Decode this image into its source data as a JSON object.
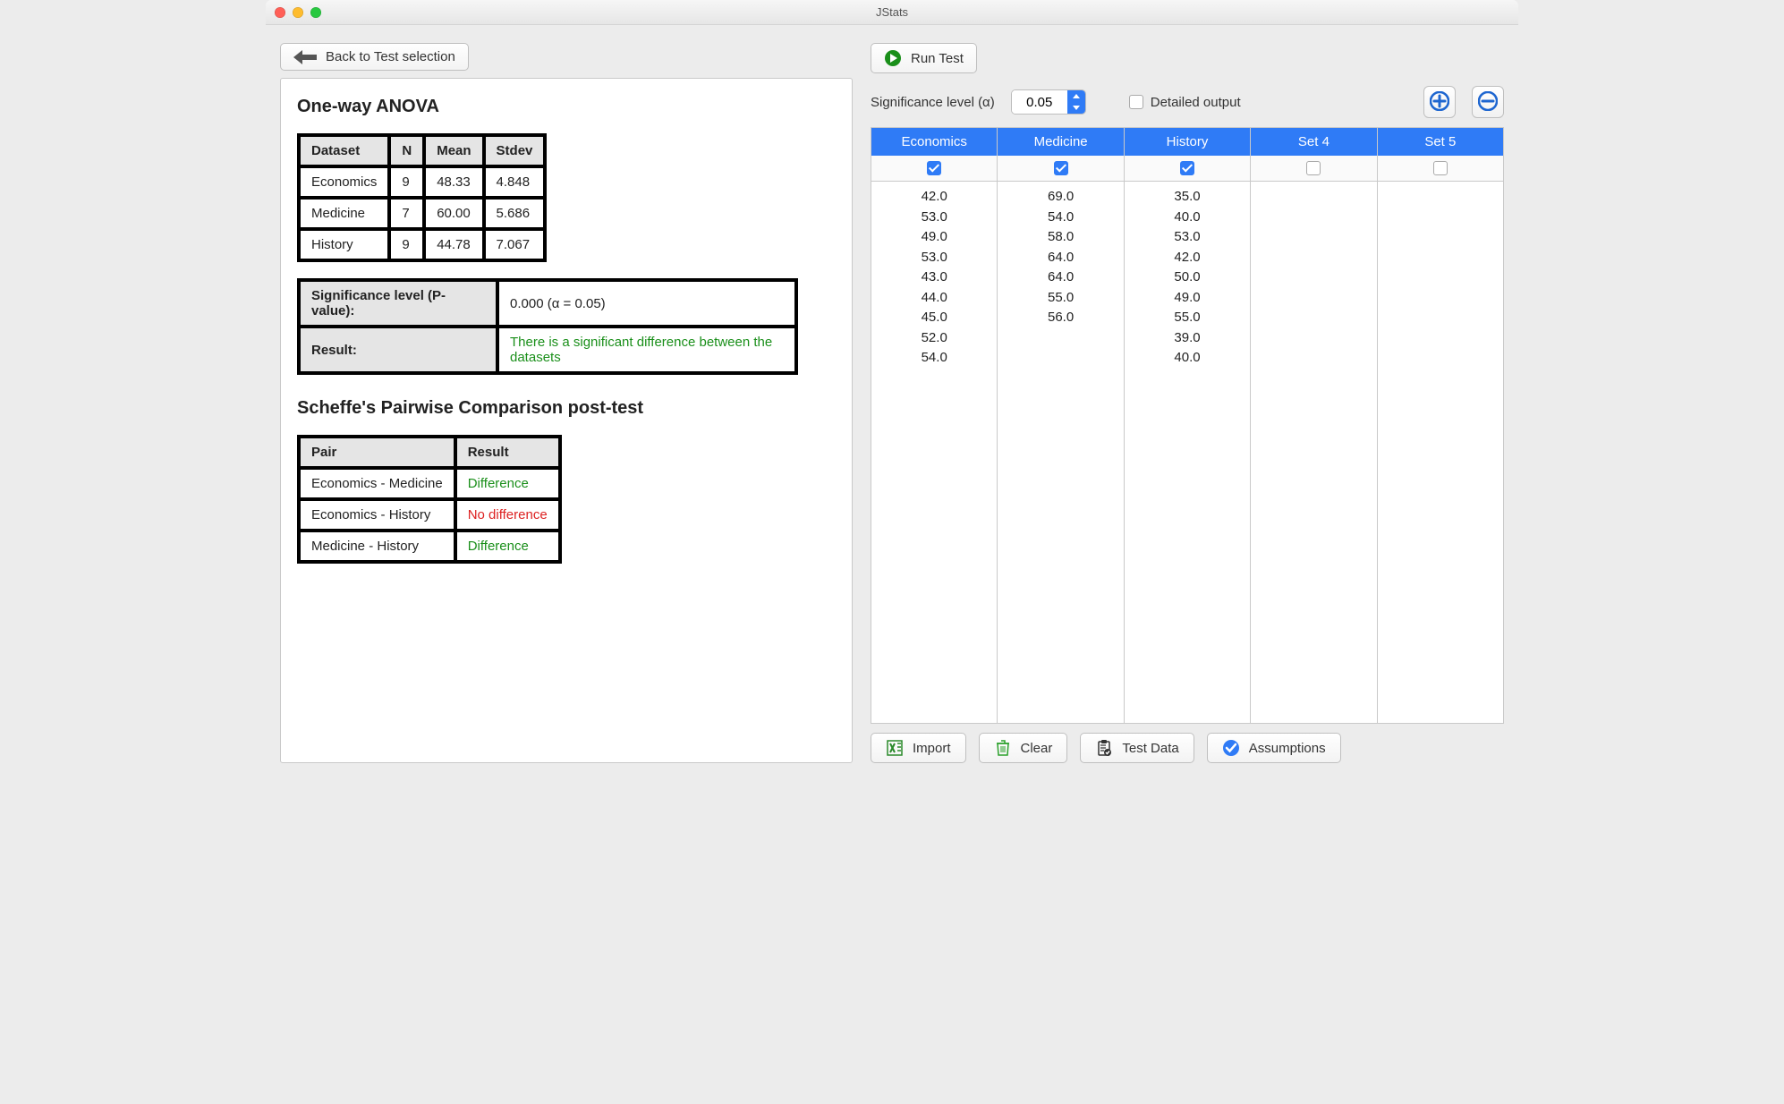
{
  "window": {
    "title": "JStats"
  },
  "buttons": {
    "back": "Back to Test selection",
    "run": "Run Test",
    "import": "Import",
    "clear": "Clear",
    "testdata": "Test Data",
    "assumptions": "Assumptions"
  },
  "options": {
    "sig_label": "Significance level (α)",
    "sig_value": "0.05",
    "detailed_label": "Detailed output"
  },
  "output": {
    "heading1": "One-way ANOVA",
    "stats_headers": {
      "dataset": "Dataset",
      "n": "N",
      "mean": "Mean",
      "stdev": "Stdev"
    },
    "stats": [
      {
        "name": "Economics",
        "n": "9",
        "mean": "48.33",
        "stdev": "4.848"
      },
      {
        "name": "Medicine",
        "n": "7",
        "mean": "60.00",
        "stdev": "5.686"
      },
      {
        "name": "History",
        "n": "9",
        "mean": "44.78",
        "stdev": "7.067"
      }
    ],
    "sig_row_label": "Significance level (P-value):",
    "sig_row_value": "0.000  (α = 0.05)",
    "result_label": "Result:",
    "result_value": "There is a significant difference between the datasets",
    "heading2": "Scheffe's Pairwise Comparison post-test",
    "pair_headers": {
      "pair": "Pair",
      "result": "Result"
    },
    "pairs": [
      {
        "pair": "Economics - Medicine",
        "result": "Difference",
        "cls": "green"
      },
      {
        "pair": "Economics - History",
        "result": "No difference",
        "cls": "red"
      },
      {
        "pair": "Medicine - History",
        "result": "Difference",
        "cls": "green"
      }
    ]
  },
  "grid": {
    "columns": [
      {
        "name": "Economics",
        "checked": true,
        "values": [
          "42.0",
          "53.0",
          "49.0",
          "53.0",
          "43.0",
          "44.0",
          "45.0",
          "52.0",
          "54.0"
        ]
      },
      {
        "name": "Medicine",
        "checked": true,
        "values": [
          "69.0",
          "54.0",
          "58.0",
          "64.0",
          "64.0",
          "55.0",
          "56.0"
        ]
      },
      {
        "name": "History",
        "checked": true,
        "values": [
          "35.0",
          "40.0",
          "53.0",
          "42.0",
          "50.0",
          "49.0",
          "55.0",
          "39.0",
          "40.0"
        ]
      },
      {
        "name": "Set 4",
        "checked": false,
        "values": []
      },
      {
        "name": "Set 5",
        "checked": false,
        "values": []
      }
    ]
  }
}
